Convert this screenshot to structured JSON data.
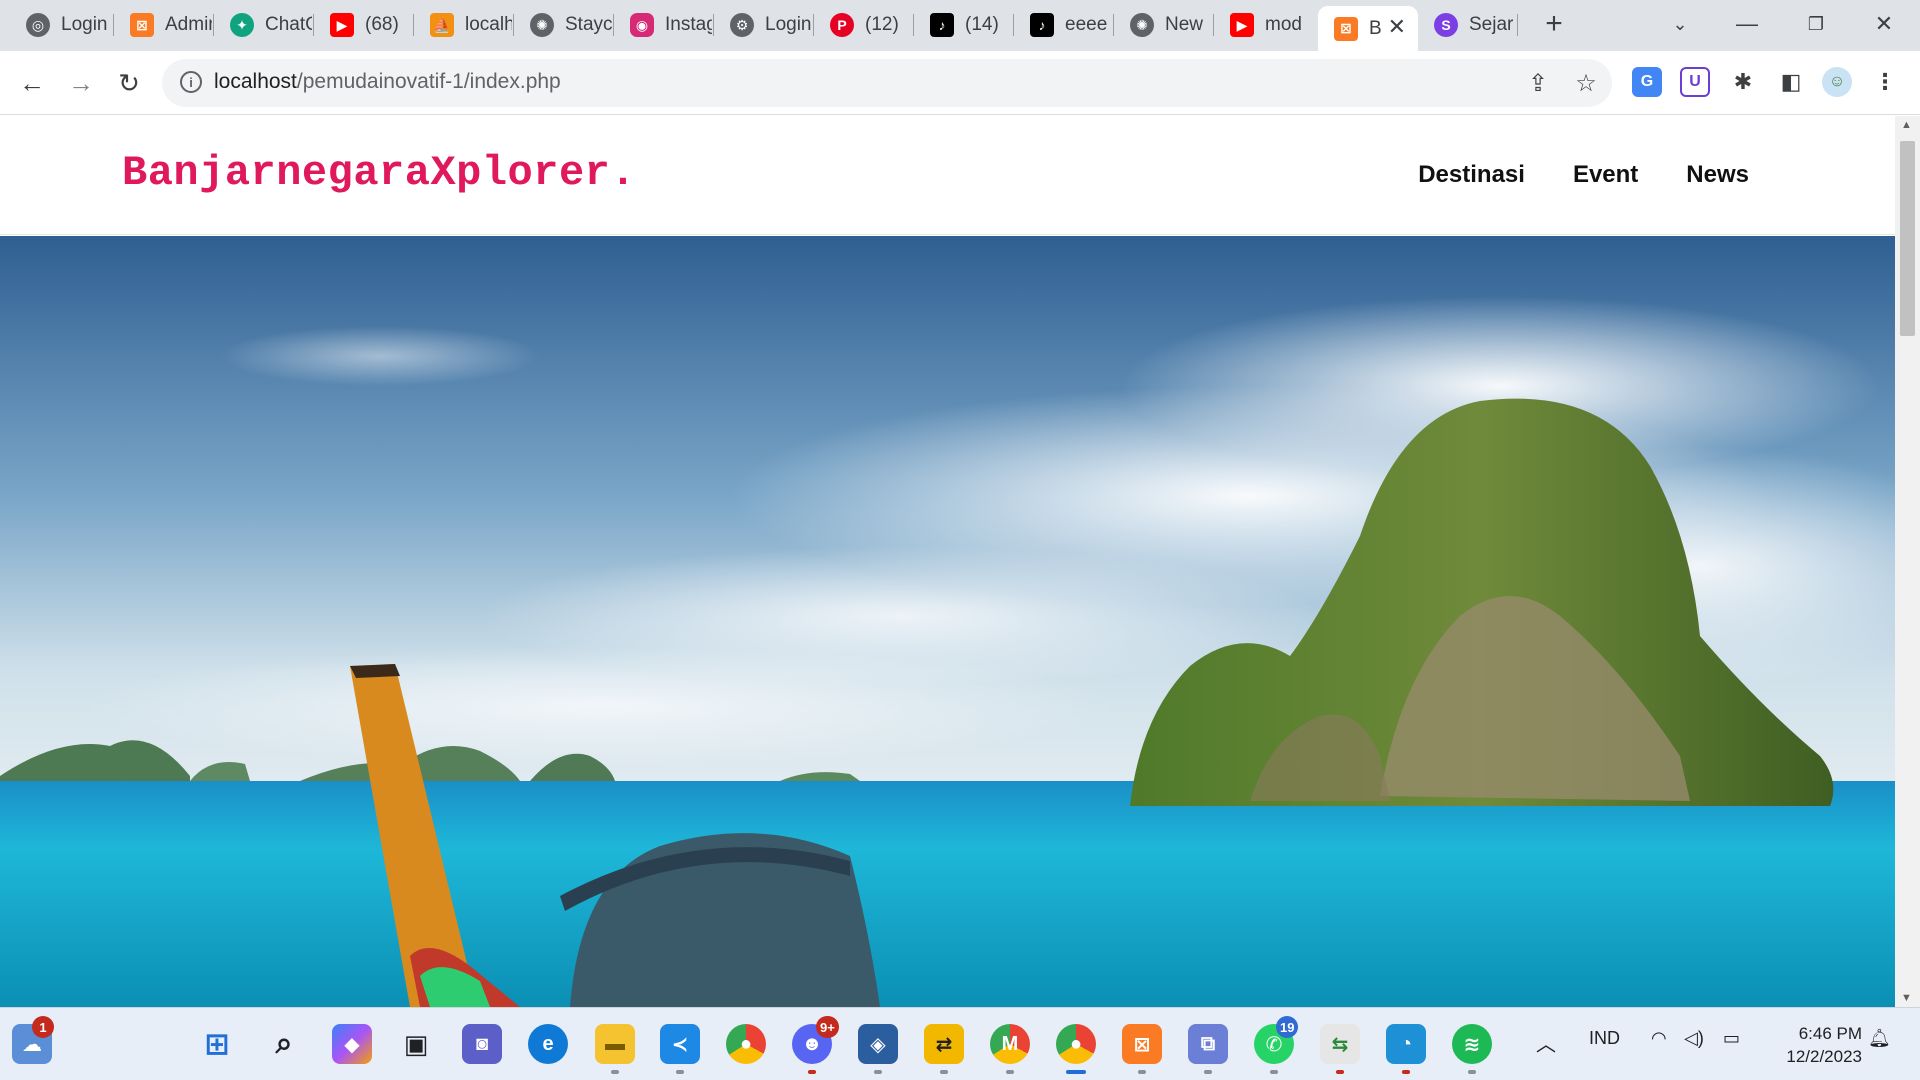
{
  "browser": {
    "tabs": [
      {
        "title": "Login",
        "icon": "chatgpt-icon",
        "color": "#5f6368"
      },
      {
        "title": "Admin",
        "icon": "xampp-icon",
        "color": "#fb7a24"
      },
      {
        "title": "ChatGPT",
        "icon": "chatgpt-icon",
        "color": "#10a37f"
      },
      {
        "title": "(68)",
        "icon": "youtube-icon",
        "color": "#ff0000"
      },
      {
        "title": "localhost",
        "icon": "phpmyadmin-icon",
        "color": "#f29111"
      },
      {
        "title": "Stayc",
        "icon": "globe-icon",
        "color": "#5f6368"
      },
      {
        "title": "Instagram",
        "icon": "instagram-icon",
        "color": "#d62976"
      },
      {
        "title": "Login",
        "icon": "globe-icon",
        "color": "#5f6368"
      },
      {
        "title": "(12)",
        "icon": "pinterest-icon",
        "color": "#e60023"
      },
      {
        "title": "(14)",
        "icon": "tiktok-icon",
        "color": "#000000"
      },
      {
        "title": "eeee",
        "icon": "tiktok-icon",
        "color": "#000000"
      },
      {
        "title": "New",
        "icon": "globe-icon",
        "color": "#5f6368"
      },
      {
        "title": "mod",
        "icon": "youtube-icon",
        "color": "#ff0000"
      },
      {
        "title": "B",
        "icon": "xampp-icon",
        "color": "#fb7a24",
        "active": true
      },
      {
        "title": "Sejar",
        "icon": "s-logo-icon",
        "color": "#7b3fe4"
      }
    ],
    "url_host": "localhost",
    "url_path": "/pemudainovatif-1/index.php"
  },
  "site": {
    "brand": "BanjarnegaraXplorer.",
    "nav": [
      "Destinasi",
      "Event",
      "News"
    ],
    "brand_color": "#e0185c"
  },
  "taskbar": {
    "widgets_badge": "1",
    "discord_badge": "9+",
    "whatsapp_badge": "19",
    "language": "IND",
    "time": "6:46 PM",
    "date": "12/2/2023"
  }
}
